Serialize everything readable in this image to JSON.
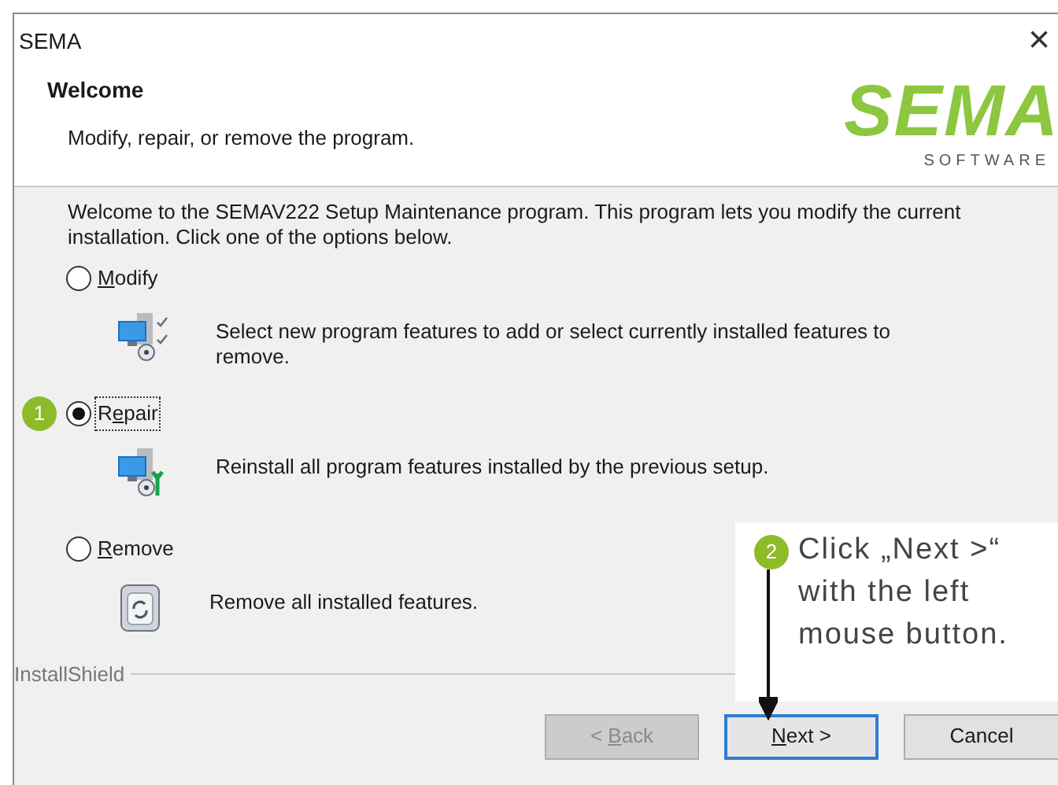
{
  "window": {
    "title": "SEMA",
    "close": "×"
  },
  "header": {
    "title": "Welcome",
    "subtitle": "Modify, repair, or remove the program.",
    "logo": "SEMA",
    "logo_tagline": "SOFTWARE"
  },
  "intro": "Welcome to the SEMAV222 Setup Maintenance program. This program lets you modify the current installation. Click one of the options below.",
  "options": [
    {
      "access_key": "M",
      "text_after": "odify",
      "selected": false,
      "kind": "modify",
      "description": "Select new program features to add or select currently installed features to remove."
    },
    {
      "text_before": "R",
      "access_key": "e",
      "text_after": "pair",
      "selected": true,
      "kind": "repair",
      "description": "Reinstall all program features installed by the previous setup.",
      "step": "1"
    },
    {
      "access_key": "R",
      "text_after": "emove",
      "selected": false,
      "kind": "remove",
      "description": "Remove all installed features."
    }
  ],
  "footer_label": "InstallShield",
  "buttons": [
    {
      "text_before": "< ",
      "access_key": "B",
      "text_after": "ack",
      "disabled": true,
      "focused": false
    },
    {
      "access_key": "N",
      "text_after": "ext >",
      "disabled": false,
      "focused": true
    },
    {
      "text_before": "Cancel",
      "disabled": false,
      "focused": false
    }
  ],
  "callout": {
    "step": "2",
    "text": "Click „Next >“ with the left mouse button."
  }
}
